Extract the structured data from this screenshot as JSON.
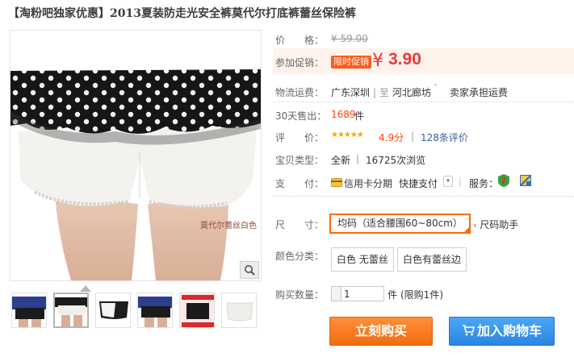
{
  "title": "【淘粉吧独家优惠】2013夏装防走光安全裤莫代尔打底裤蕾丝保险裤",
  "image": {
    "watermark": "莫代尔蕾丝白色"
  },
  "price": {
    "label": "价　　格：",
    "old": "¥ 59.00"
  },
  "promo": {
    "label": "参加促销：",
    "tag": "限时促销",
    "symbol": "¥",
    "price": "3.90"
  },
  "shipping": {
    "label": "物流运费：",
    "from": "广东深圳",
    "sep": "| 至",
    "to": "河北廊坊",
    "arrow": "˅",
    "fee": "卖家承担运费"
  },
  "sales": {
    "label": "30天售出：",
    "count": "1689",
    "unit": "件"
  },
  "rating": {
    "label": "评　　价：",
    "stars": "★★★★★",
    "score": "4.9分",
    "sep": "|",
    "reviews": "128条评价"
  },
  "item_type": {
    "label": "宝贝类型：",
    "condition": "全新",
    "sep": "|",
    "views": "16725次浏览"
  },
  "payment": {
    "label": "支　　付：",
    "credit": "信用卡分期",
    "quick": "快捷支付",
    "dropdown": "▾",
    "service_label": "服务："
  },
  "size": {
    "label": "尺　　寸：",
    "selected": "均码（适合腰围60~80cm）",
    "help": "尺码助手"
  },
  "color": {
    "label": "颜色分类：",
    "options": [
      "白色 无蕾丝",
      "白色有蕾丝边"
    ]
  },
  "quantity": {
    "label": "购买数量：",
    "value": "1",
    "unit": "件",
    "limit": "(限购1件)"
  },
  "buttons": {
    "buy": "立刻购买",
    "cart": "加入购物车"
  },
  "colors": {
    "accent": "#ff5b1c",
    "price": "#e4393c",
    "buy": "#f47a20",
    "cart": "#3a96ea"
  }
}
